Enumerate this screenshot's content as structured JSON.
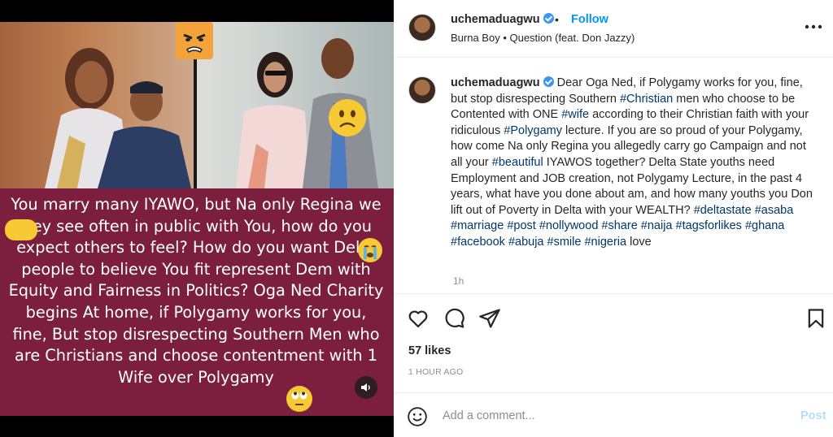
{
  "media": {
    "caption_text": "You marry many IYAWO, but Na only Regina we Dey see often in public with You, how do you expect others to feel? How do you want Delta people to believe You fit represent Dem with Equity and Fairness in Politics? Oga Ned Charity begins At home, if Polygamy works for you, fine, But stop disrespecting Southern Men who are Christians and choose contentment with 1 Wife over Polygamy",
    "accent_color": "#7c1f3e"
  },
  "header": {
    "username": "uchemaduagwu",
    "separator": "•",
    "follow_label": "Follow",
    "music": "Burna Boy • Question (feat. Don Jazzy)",
    "more_label": "•••"
  },
  "post": {
    "username": "uchemaduagwu",
    "caption_parts": [
      {
        "t": "Dear Oga Ned, if Polygamy works for you, fine, but stop disrespecting Southern "
      },
      {
        "tag": "#Christian"
      },
      {
        "t": " men who choose to be Contented with ONE "
      },
      {
        "tag": "#wife"
      },
      {
        "t": " according to their Christian faith with your ridiculous "
      },
      {
        "tag": "#Polygamy"
      },
      {
        "t": " lecture. If you are so proud of your Polygamy, how come Na only Regina you allegedly carry go Campaign and not all your "
      },
      {
        "tag": "#beautiful"
      },
      {
        "t": " IYAWOS together? Delta State youths need Employment and JOB creation, not Polygamy Lecture, in the past 4 years, what have you done about am, and how many youths you Don lift out of Poverty in Delta with your WEALTH? "
      },
      {
        "tag": "#deltastate"
      },
      {
        "t": " "
      },
      {
        "tag": "#asaba"
      },
      {
        "t": " "
      },
      {
        "tag": "#marriage"
      },
      {
        "t": " "
      },
      {
        "tag": "#post"
      },
      {
        "t": " "
      },
      {
        "tag": "#nollywood"
      },
      {
        "t": " "
      },
      {
        "tag": "#share"
      },
      {
        "t": " "
      },
      {
        "tag": "#naija"
      },
      {
        "t": " "
      },
      {
        "tag": "#tagsforlikes"
      },
      {
        "t": " "
      },
      {
        "tag": "#ghana"
      },
      {
        "t": " "
      },
      {
        "tag": "#facebook"
      },
      {
        "t": " "
      },
      {
        "tag": "#abuja"
      },
      {
        "t": " "
      },
      {
        "tag": "#smile"
      },
      {
        "t": " "
      },
      {
        "tag": "#nigeria"
      },
      {
        "t": " love"
      }
    ],
    "time_ago": "1h",
    "likes": "57 likes",
    "posted": "1 HOUR AGO"
  },
  "comment": {
    "placeholder": "Add a comment...",
    "post_label": "Post"
  },
  "icons": [
    "heart-icon",
    "comment-icon",
    "share-icon",
    "bookmark-icon",
    "emoji-icon",
    "volume-icon",
    "more-icon"
  ],
  "colors": {
    "link": "#0095f6",
    "hashtag": "#00376b",
    "muted": "#8e8e8e",
    "post_disabled": "#b2dffc"
  }
}
